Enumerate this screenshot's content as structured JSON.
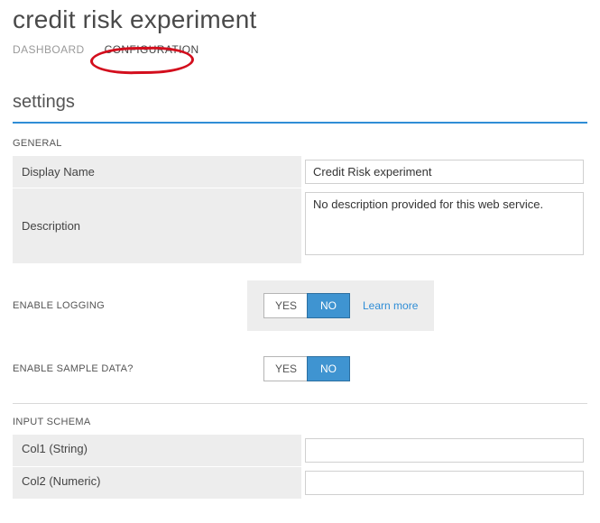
{
  "header": {
    "title": "credit risk experiment",
    "tabs": [
      {
        "label": "DASHBOARD",
        "active": false
      },
      {
        "label": "CONFIGURATION",
        "active": true
      }
    ]
  },
  "settings_heading": "settings",
  "general": {
    "section_label": "GENERAL",
    "display_name_label": "Display Name",
    "display_name_value": "Credit Risk experiment",
    "description_label": "Description",
    "description_value": "No description provided for this web service."
  },
  "logging": {
    "label": "ENABLE LOGGING",
    "options": {
      "yes": "YES",
      "no": "NO"
    },
    "selected": "NO",
    "learn_more": "Learn more"
  },
  "sample_data": {
    "label": "ENABLE SAMPLE DATA?",
    "options": {
      "yes": "YES",
      "no": "NO"
    },
    "selected": "NO"
  },
  "input_schema": {
    "section_label": "INPUT SCHEMA",
    "rows": [
      {
        "label": "Col1 (String)",
        "value": ""
      },
      {
        "label": "Col2 (Numeric)",
        "value": ""
      }
    ]
  }
}
